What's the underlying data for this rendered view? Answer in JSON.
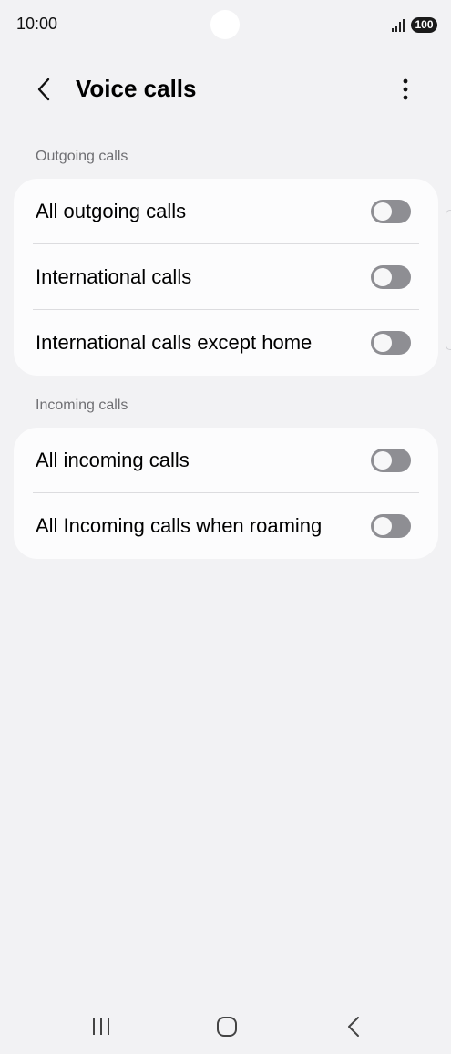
{
  "status_bar": {
    "time": "10:00",
    "battery": "100",
    "signal_icon": "signal-bars-icon"
  },
  "header": {
    "title": "Voice calls",
    "back_icon": "chevron-left-icon",
    "more_icon": "more-vertical-icon"
  },
  "sections": [
    {
      "heading": "Outgoing calls",
      "items": [
        {
          "label": "All outgoing calls",
          "enabled": false
        },
        {
          "label": "International calls",
          "enabled": false
        },
        {
          "label": "International calls except home",
          "enabled": false
        }
      ]
    },
    {
      "heading": "Incoming calls",
      "items": [
        {
          "label": "All incoming calls",
          "enabled": false
        },
        {
          "label": "All Incoming calls when roaming",
          "enabled": false
        }
      ]
    }
  ],
  "nav_bar": {
    "recents_icon": "recent-apps-icon",
    "home_icon": "home-icon",
    "back_icon": "back-icon"
  },
  "colors": {
    "background": "#f2f2f4",
    "card": "#fcfcfd",
    "toggle_off": "#8e8e93",
    "section_heading": "#6f6f73"
  }
}
